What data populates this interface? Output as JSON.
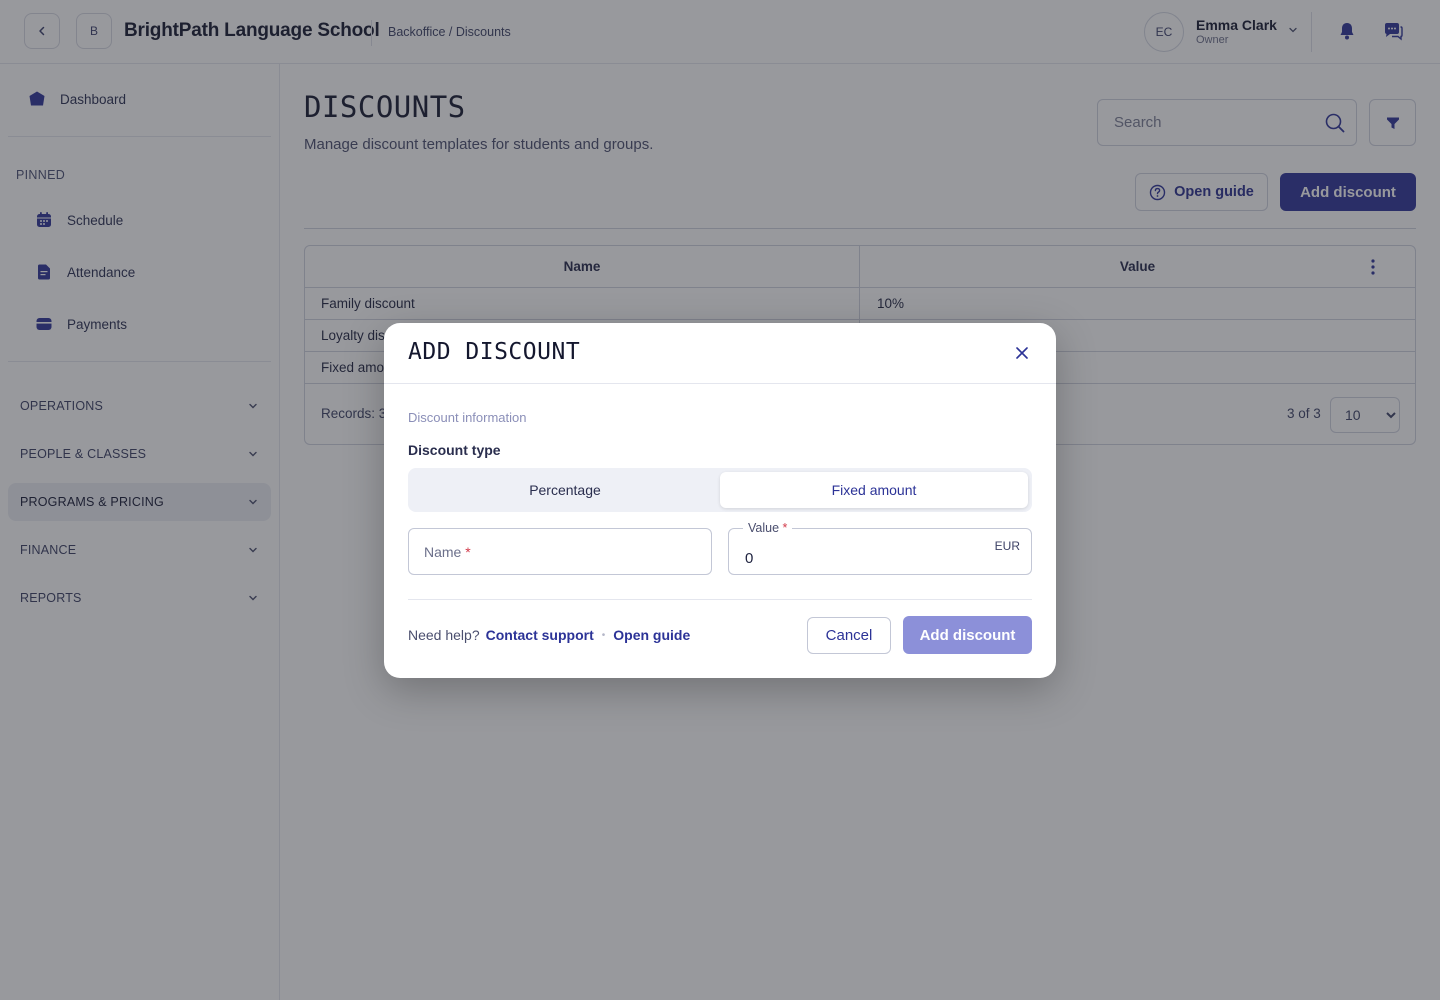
{
  "header": {
    "back_icon": "chevron-left-icon",
    "org_initial": "B",
    "org_name": "BrightPath Language School",
    "breadcrumb": "Backoffice / Discounts",
    "user": {
      "initials": "EC",
      "name": "Emma Clark",
      "role": "Owner"
    },
    "icons": [
      "bell-icon",
      "chat-icon"
    ]
  },
  "sidebar": {
    "dashboard": "Dashboard",
    "pinned_label": "PINNED",
    "pinned": [
      {
        "label": "Schedule",
        "icon": "calendar-icon"
      },
      {
        "label": "Attendance",
        "icon": "clipboard-icon"
      },
      {
        "label": "Payments",
        "icon": "wallet-icon"
      }
    ],
    "groups": [
      {
        "label": "OPERATIONS"
      },
      {
        "label": "PEOPLE & CLASSES"
      },
      {
        "label": "PROGRAMS & PRICING",
        "active": true
      },
      {
        "label": "FINANCE"
      },
      {
        "label": "REPORTS"
      }
    ]
  },
  "main": {
    "title": "DISCOUNTS",
    "subtitle": "Manage discount templates for students and groups.",
    "search_placeholder": "Search",
    "open_guide": "Open guide",
    "add_discount": "Add discount",
    "table": {
      "columns": [
        "Name",
        "Value"
      ],
      "rows": [
        {
          "name": "Family discount",
          "value": "10%"
        },
        {
          "name": "Loyalty dis",
          "value": ""
        },
        {
          "name": "Fixed amo",
          "value": ""
        }
      ],
      "records": "Records: 3",
      "pager": "3 of 3",
      "page_size": "10"
    }
  },
  "modal": {
    "title": "ADD DISCOUNT",
    "section": "Discount information",
    "type_label": "Discount type",
    "options": [
      "Percentage",
      "Fixed amount"
    ],
    "selected_option": "Fixed amount",
    "name_placeholder": "Name",
    "value_label": "Value",
    "required_mark": "*",
    "value": "0",
    "currency": "EUR",
    "need_help": "Need help?",
    "contact_support": "Contact support",
    "separator": "•",
    "open_guide": "Open guide",
    "cancel": "Cancel",
    "submit": "Add discount"
  },
  "colors": {
    "accent": "#2c3397",
    "accent_disabled": "#8c90d9",
    "required": "#d23a4a"
  }
}
